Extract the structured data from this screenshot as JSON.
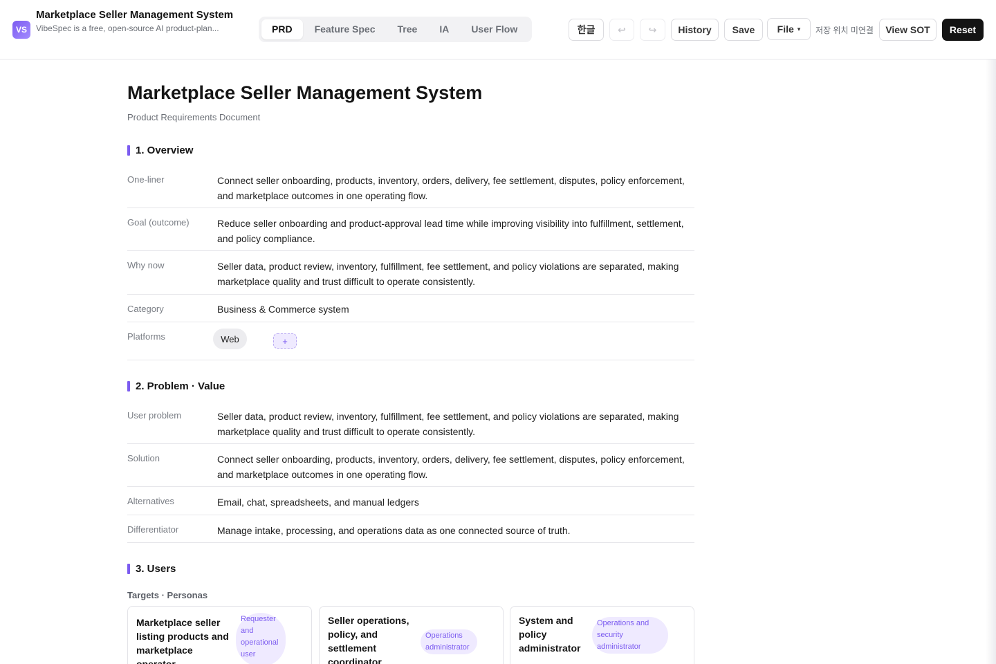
{
  "header": {
    "logo_text": "VS",
    "app_title": "Marketplace Seller Management System",
    "app_subtitle": "VibeSpec is a free, open-source AI product-plan...",
    "tabs": [
      {
        "label": "PRD",
        "active": true
      },
      {
        "label": "Feature Spec",
        "active": false
      },
      {
        "label": "Tree",
        "active": false
      },
      {
        "label": "IA",
        "active": false
      },
      {
        "label": "User Flow",
        "active": false
      }
    ],
    "lang_label": "한글",
    "undo_icon": "↩",
    "redo_icon": "↪",
    "history_label": "History",
    "save_label": "Save",
    "file_label": "File",
    "file_caret": "▾",
    "save_location": "저장 위치 미연결",
    "view_sot_label": "View SOT",
    "reset_label": "Reset"
  },
  "doc": {
    "title": "Marketplace Seller Management System",
    "subtitle": "Product Requirements Document",
    "overview": {
      "heading": "1. Overview",
      "rows": [
        {
          "key": "One-liner",
          "value": "Connect seller onboarding, products, inventory, orders, delivery, fee settlement, disputes, policy enforcement, and marketplace outcomes in one operating flow."
        },
        {
          "key": "Goal (outcome)",
          "value": "Reduce seller onboarding and product-approval lead time while improving visibility into fulfillment, settlement, and policy compliance."
        },
        {
          "key": "Why now",
          "value": "Seller data, product review, inventory, fulfillment, fee settlement, and policy violations are separated, making marketplace quality and trust difficult to operate consistently."
        },
        {
          "key": "Category",
          "value": "Business & Commerce system"
        }
      ],
      "platforms_label": "Platforms",
      "platforms": [
        "Web"
      ],
      "add_platform": "+"
    },
    "problem": {
      "heading": "2. Problem · Value",
      "rows": [
        {
          "key": "User problem",
          "value": "Seller data, product review, inventory, fulfillment, fee settlement, and policy violations are separated, making marketplace quality and trust difficult to operate consistently."
        },
        {
          "key": "Solution",
          "value": "Connect seller onboarding, products, inventory, orders, delivery, fee settlement, disputes, policy enforcement, and marketplace outcomes in one operating flow."
        },
        {
          "key": "Alternatives",
          "value": "Email, chat, spreadsheets, and manual ledgers"
        },
        {
          "key": "Differentiator",
          "value": "Manage intake, processing, and operations data as one connected source of truth."
        }
      ]
    },
    "users": {
      "heading": "3. Users",
      "subheading": "Targets · Personas",
      "cards": [
        {
          "title": "Marketplace seller listing products and marketplace operator",
          "badge": "Requester and operational user"
        },
        {
          "title": "Seller operations, policy, and settlement coordinator",
          "badge": "Operations administrator"
        },
        {
          "title": "System and policy administrator",
          "badge": "Operations and security administrator"
        }
      ]
    }
  }
}
